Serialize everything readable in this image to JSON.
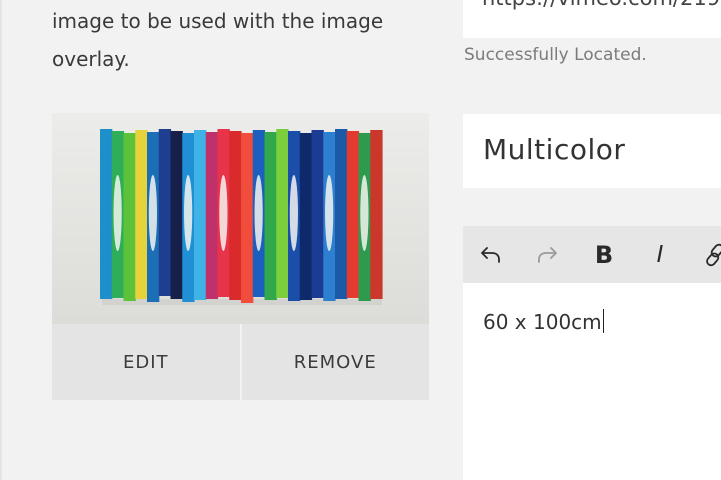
{
  "image_panel": {
    "help_text": "image to be used with the image overlay.",
    "image_alt": "Multicolor striped artwork",
    "edit_label": "EDIT",
    "remove_label": "REMOVE"
  },
  "video": {
    "url_value": "https://vimeo.com/219",
    "status": "Successfully Located."
  },
  "title_field": {
    "value": "Multicolor"
  },
  "toolbar": {
    "items": [
      {
        "name": "undo-icon"
      },
      {
        "name": "redo-icon",
        "disabled": true
      },
      {
        "name": "bold-icon",
        "glyph": "B"
      },
      {
        "name": "italic-icon",
        "glyph": "I"
      },
      {
        "name": "link-icon"
      }
    ]
  },
  "editor": {
    "value": "60 x 100cm"
  },
  "colors": {
    "background": "#f2f2f2",
    "button_bg": "#e4e4e4",
    "toolbar_bg": "#e6e6e6",
    "field_bg": "#ffffff",
    "status_text": "#7b7b7b"
  }
}
